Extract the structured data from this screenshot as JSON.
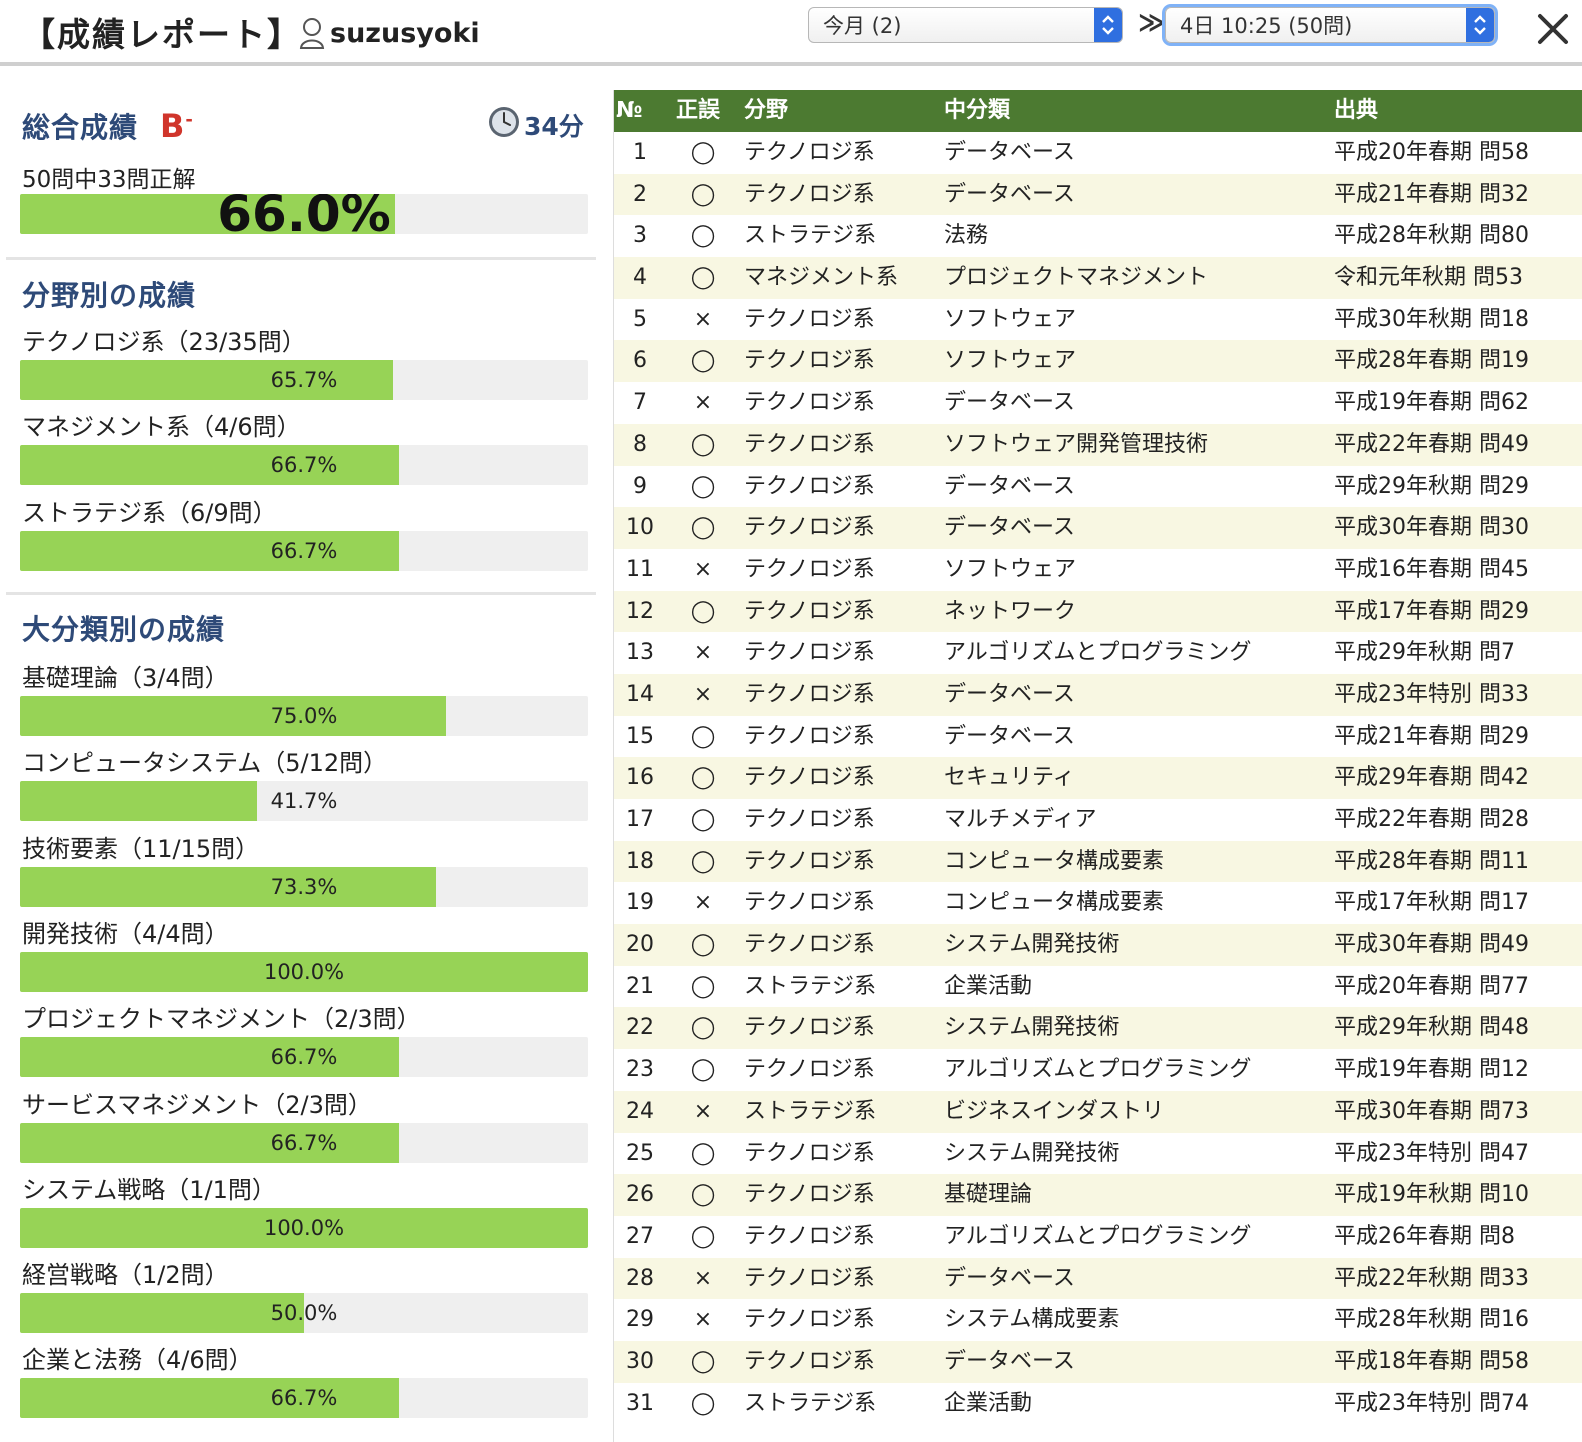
{
  "header": {
    "title": "【成績レポート】",
    "user": "suzusyoki",
    "month_select": "今月 (2)",
    "session_select": "4日 10:25 (50問)",
    "arrow": "≫",
    "close": "×"
  },
  "summary": {
    "heading": "総合成績",
    "grade": "B",
    "grade_suffix": "-",
    "time": "34分",
    "detail": "50問中33問正解",
    "percent_text": "66.0%",
    "percent": 66.0
  },
  "by_field": {
    "heading": "分野別の成績",
    "items": [
      {
        "label": "テクノロジ系（23/35問）",
        "pct_text": "65.7%",
        "pct": 65.7
      },
      {
        "label": "マネジメント系（4/6問）",
        "pct_text": "66.7%",
        "pct": 66.7
      },
      {
        "label": "ストラテジ系（6/9問）",
        "pct_text": "66.7%",
        "pct": 66.7
      }
    ]
  },
  "by_category": {
    "heading": "大分類別の成績",
    "items": [
      {
        "label": "基礎理論（3/4問）",
        "pct_text": "75.0%",
        "pct": 75.0
      },
      {
        "label": "コンピュータシステム（5/12問）",
        "pct_text": "41.7%",
        "pct": 41.7
      },
      {
        "label": "技術要素（11/15問）",
        "pct_text": "73.3%",
        "pct": 73.3
      },
      {
        "label": "開発技術（4/4問）",
        "pct_text": "100.0%",
        "pct": 100.0
      },
      {
        "label": "プロジェクトマネジメント（2/3問）",
        "pct_text": "66.7%",
        "pct": 66.7
      },
      {
        "label": "サービスマネジメント（2/3問）",
        "pct_text": "66.7%",
        "pct": 66.7
      },
      {
        "label": "システム戦略（1/1問）",
        "pct_text": "100.0%",
        "pct": 100.0
      },
      {
        "label": "経営戦略（1/2問）",
        "pct_text": "50.0%",
        "pct": 50.0
      },
      {
        "label": "企業と法務（4/6問）",
        "pct_text": "66.7%",
        "pct": 66.7
      }
    ]
  },
  "table": {
    "columns": [
      "№",
      "正誤",
      "分野",
      "中分類",
      "出典"
    ],
    "rows": [
      {
        "no": "1",
        "mark": "◯",
        "field": "テクノロジ系",
        "mid": "データベース",
        "src": "平成20年春期 問58"
      },
      {
        "no": "2",
        "mark": "◯",
        "field": "テクノロジ系",
        "mid": "データベース",
        "src": "平成21年春期 問32"
      },
      {
        "no": "3",
        "mark": "◯",
        "field": "ストラテジ系",
        "mid": "法務",
        "src": "平成28年秋期 問80"
      },
      {
        "no": "4",
        "mark": "◯",
        "field": "マネジメント系",
        "mid": "プロジェクトマネジメント",
        "src": "令和元年秋期 問53"
      },
      {
        "no": "5",
        "mark": "×",
        "field": "テクノロジ系",
        "mid": "ソフトウェア",
        "src": "平成30年秋期 問18"
      },
      {
        "no": "6",
        "mark": "◯",
        "field": "テクノロジ系",
        "mid": "ソフトウェア",
        "src": "平成28年春期 問19"
      },
      {
        "no": "7",
        "mark": "×",
        "field": "テクノロジ系",
        "mid": "データベース",
        "src": "平成19年春期 問62"
      },
      {
        "no": "8",
        "mark": "◯",
        "field": "テクノロジ系",
        "mid": "ソフトウェア開発管理技術",
        "src": "平成22年春期 問49"
      },
      {
        "no": "9",
        "mark": "◯",
        "field": "テクノロジ系",
        "mid": "データベース",
        "src": "平成29年秋期 問29"
      },
      {
        "no": "10",
        "mark": "◯",
        "field": "テクノロジ系",
        "mid": "データベース",
        "src": "平成30年春期 問30"
      },
      {
        "no": "11",
        "mark": "×",
        "field": "テクノロジ系",
        "mid": "ソフトウェア",
        "src": "平成16年春期 問45"
      },
      {
        "no": "12",
        "mark": "◯",
        "field": "テクノロジ系",
        "mid": "ネットワーク",
        "src": "平成17年春期 問29"
      },
      {
        "no": "13",
        "mark": "×",
        "field": "テクノロジ系",
        "mid": "アルゴリズムとプログラミング",
        "src": "平成29年秋期 問7"
      },
      {
        "no": "14",
        "mark": "×",
        "field": "テクノロジ系",
        "mid": "データベース",
        "src": "平成23年特別 問33"
      },
      {
        "no": "15",
        "mark": "◯",
        "field": "テクノロジ系",
        "mid": "データベース",
        "src": "平成21年春期 問29"
      },
      {
        "no": "16",
        "mark": "◯",
        "field": "テクノロジ系",
        "mid": "セキュリティ",
        "src": "平成29年春期 問42"
      },
      {
        "no": "17",
        "mark": "◯",
        "field": "テクノロジ系",
        "mid": "マルチメディア",
        "src": "平成22年春期 問28"
      },
      {
        "no": "18",
        "mark": "◯",
        "field": "テクノロジ系",
        "mid": "コンピュータ構成要素",
        "src": "平成28年春期 問11"
      },
      {
        "no": "19",
        "mark": "×",
        "field": "テクノロジ系",
        "mid": "コンピュータ構成要素",
        "src": "平成17年秋期 問17"
      },
      {
        "no": "20",
        "mark": "◯",
        "field": "テクノロジ系",
        "mid": "システム開発技術",
        "src": "平成30年春期 問49"
      },
      {
        "no": "21",
        "mark": "◯",
        "field": "ストラテジ系",
        "mid": "企業活動",
        "src": "平成20年春期 問77"
      },
      {
        "no": "22",
        "mark": "◯",
        "field": "テクノロジ系",
        "mid": "システム開発技術",
        "src": "平成29年秋期 問48"
      },
      {
        "no": "23",
        "mark": "◯",
        "field": "テクノロジ系",
        "mid": "アルゴリズムとプログラミング",
        "src": "平成19年春期 問12"
      },
      {
        "no": "24",
        "mark": "×",
        "field": "ストラテジ系",
        "mid": "ビジネスインダストリ",
        "src": "平成30年春期 問73"
      },
      {
        "no": "25",
        "mark": "◯",
        "field": "テクノロジ系",
        "mid": "システム開発技術",
        "src": "平成23年特別 問47"
      },
      {
        "no": "26",
        "mark": "◯",
        "field": "テクノロジ系",
        "mid": "基礎理論",
        "src": "平成19年秋期 問10"
      },
      {
        "no": "27",
        "mark": "◯",
        "field": "テクノロジ系",
        "mid": "アルゴリズムとプログラミング",
        "src": "平成26年春期 問8"
      },
      {
        "no": "28",
        "mark": "×",
        "field": "テクノロジ系",
        "mid": "データベース",
        "src": "平成22年秋期 問33"
      },
      {
        "no": "29",
        "mark": "×",
        "field": "テクノロジ系",
        "mid": "システム構成要素",
        "src": "平成28年秋期 問16"
      },
      {
        "no": "30",
        "mark": "◯",
        "field": "テクノロジ系",
        "mid": "データベース",
        "src": "平成18年春期 問58"
      },
      {
        "no": "31",
        "mark": "◯",
        "field": "ストラテジ系",
        "mid": "企業活動",
        "src": "平成23年特別 問74"
      }
    ]
  },
  "colors": {
    "accent_heading": "#2e4a78",
    "grade": "#d0352b",
    "bar_fill": "#97d356",
    "table_header": "#4c7a31",
    "row_alt": "#f8f7e2"
  },
  "icons": {
    "user": "user-outline-icon",
    "clock": "clock-icon",
    "select_arrows": "updown-chevron-icon",
    "close": "close-icon"
  }
}
